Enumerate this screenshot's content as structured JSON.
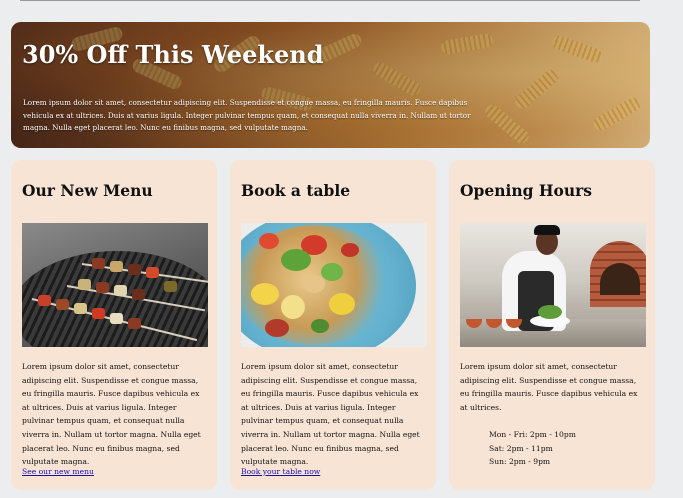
{
  "hero": {
    "title": "30% Off This Weekend",
    "text": "Lorem ipsum dolor sit amet, consectetur adipiscing elit. Suspendisse et congue massa, eu fringilla mauris. Fusce dapibus vehicula ex at ultrices. Duis at varius ligula. Integer pulvinar tempus quam, et consequat nulla viverra in. Nullam ut tortor magna. Nulla eget placerat leo. Nunc eu finibus magna, sed vulputate magna."
  },
  "cards": {
    "menu": {
      "title": "Our New Menu",
      "text": "Lorem ipsum dolor sit amet, consectetur adipiscing elit. Suspendisse et congue massa, eu fringilla mauris. Fusce dapibus vehicula ex at ultrices. Duis at varius ligula. Integer pulvinar tempus quam, et consequat nulla viverra in. Nullam ut tortor magna. Nulla eget placerat leo. Nunc eu finibus magna, sed vulputate magna.",
      "link": "See our new menu"
    },
    "table": {
      "title": "Book a table",
      "text": "Lorem ipsum dolor sit amet, consectetur adipiscing elit. Suspendisse et congue massa, eu fringilla mauris. Fusce dapibus vehicula ex at ultrices. Duis at varius ligula. Integer pulvinar tempus quam, et consequat nulla viverra in. Nullam ut tortor magna. Nulla eget placerat leo. Nunc eu finibus magna, sed vulputate magna.",
      "link": "Book your table now"
    },
    "hours": {
      "title": "Opening Hours",
      "text": "Lorem ipsum dolor sit amet, consectetur adipiscing elit. Suspendisse et congue massa, eu fringilla mauris. Fusce dapibus vehicula ex at ultrices.",
      "schedule": [
        "Mon - Fri: 2pm - 10pm",
        "Sat: 2pm - 11pm",
        "Sun: 2pm - 9pm"
      ]
    }
  },
  "colors": {
    "page_bg": "#ecedee",
    "card_bg": "#f8e4d5",
    "link": "#1a0dab",
    "hero_text": "#ffffff"
  }
}
